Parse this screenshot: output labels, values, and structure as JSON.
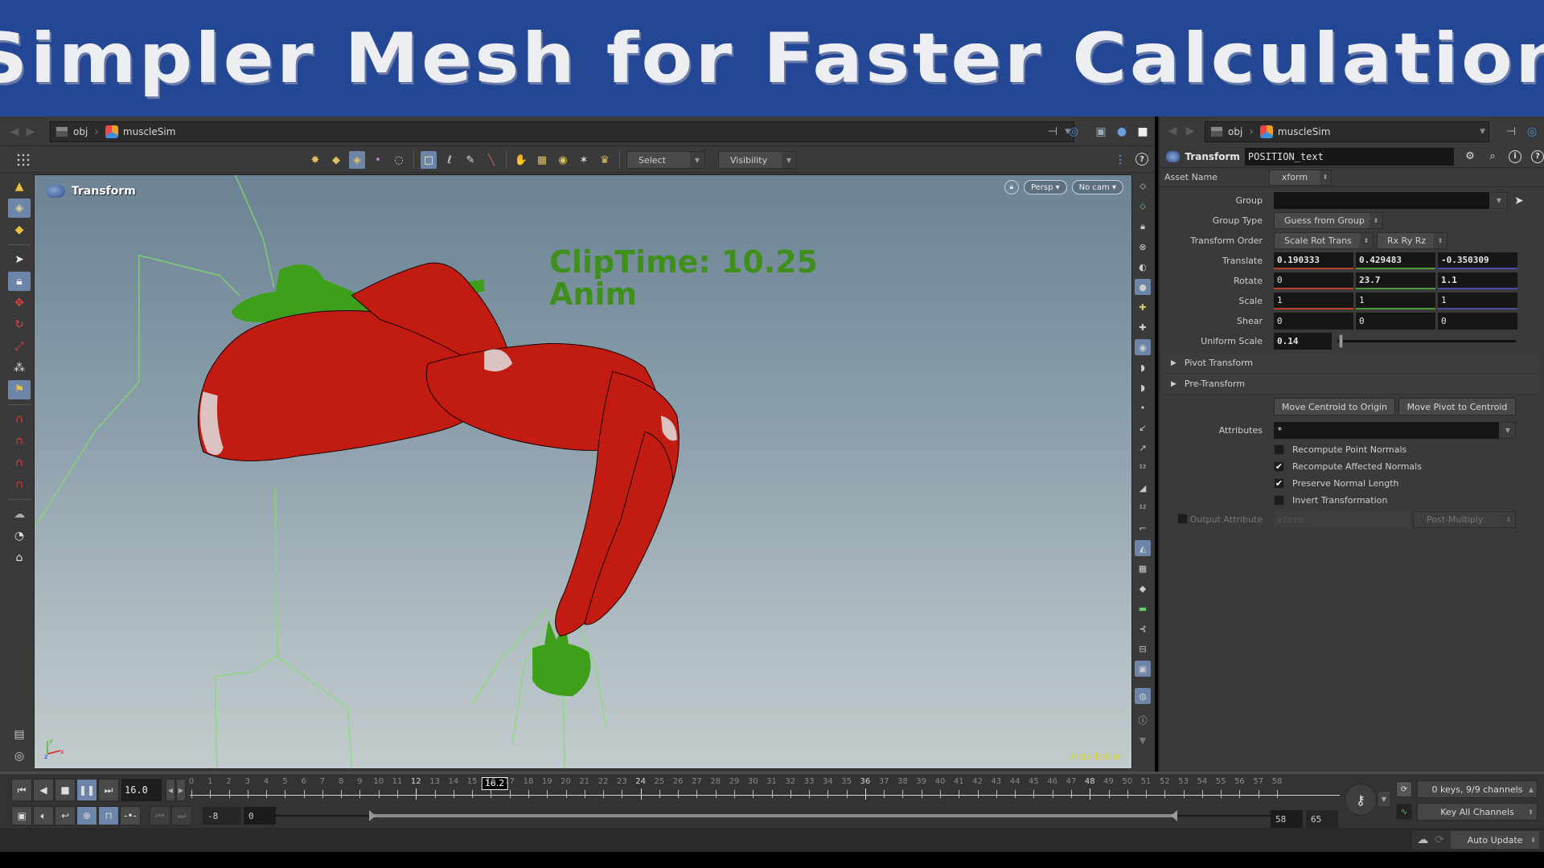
{
  "banner": {
    "title": "Simpler Mesh for Faster Calculation"
  },
  "left_pane": {
    "path": [
      "obj",
      "muscleSim"
    ],
    "toolbar": {
      "select_label": "Select",
      "visibility_label": "Visibility"
    },
    "viewport": {
      "operator_title": "Transform",
      "camera_persp": "Persp ▾",
      "camera_nocam": "No cam ▾",
      "overlay_line1": "ClipTime: 10.25",
      "overlay_line2": "Anim",
      "edition_label": "Indie Edition",
      "axes": {
        "x": "x",
        "y": "y",
        "z": "z"
      },
      "colors": {
        "muscle": "#c21c12",
        "bone": "#3ea01a",
        "wire": "#7fe06a",
        "overlay_text": "#3f8f1c"
      }
    }
  },
  "right_pane": {
    "path": [
      "obj",
      "muscleSim"
    ],
    "node": {
      "type": "Transform",
      "name": "POSITION_text"
    },
    "asset_name": {
      "label": "Asset Name",
      "value": "xform"
    },
    "params": {
      "group": {
        "label": "Group",
        "value": ""
      },
      "group_type": {
        "label": "Group Type",
        "value": "Guess from Group"
      },
      "transform_order": {
        "label": "Transform Order",
        "value": "Scale Rot Trans",
        "rot_order": "Rx Ry Rz"
      },
      "translate": {
        "label": "Translate",
        "x": "0.190333",
        "y": "0.429483",
        "z": "-0.350309"
      },
      "rotate": {
        "label": "Rotate",
        "x": "0",
        "y": "23.7",
        "z": "1.1"
      },
      "scale": {
        "label": "Scale",
        "x": "1",
        "y": "1",
        "z": "1"
      },
      "shear": {
        "label": "Shear",
        "x": "0",
        "y": "0",
        "z": "0"
      },
      "uniform_scale": {
        "label": "Uniform Scale",
        "value": "0.14"
      },
      "pivot_transform": "Pivot Transform",
      "pre_transform": "Pre-Transform",
      "move_centroid_button": "Move Centroid to Origin",
      "move_pivot_button": "Move Pivot to Centroid",
      "attributes": {
        "label": "Attributes",
        "value": "*"
      },
      "checkboxes": [
        {
          "label": "Recompute Point Normals",
          "checked": false
        },
        {
          "label": "Recompute Affected Normals",
          "checked": true
        },
        {
          "label": "Preserve Normal Length",
          "checked": true
        },
        {
          "label": "Invert Transformation",
          "checked": false
        }
      ],
      "output_attribute": {
        "label": "Output Attribute",
        "value": "xform",
        "mode": "Post-Multiply",
        "enabled": false
      }
    }
  },
  "timeline": {
    "current_frame_field": "16.0",
    "current_frame_marker": "16.2",
    "ruler_start": 0,
    "ruler_end": 58,
    "major_ticks": [
      12,
      24,
      36,
      48
    ],
    "range_start_field": "-8",
    "range_playback_start": "0",
    "range_playback_end": "58",
    "range_end_field": "65",
    "keys_status": "0 keys, 9/9 channels",
    "key_mode": "Key All Channels"
  },
  "statusbar": {
    "update_mode": "Auto Update"
  }
}
